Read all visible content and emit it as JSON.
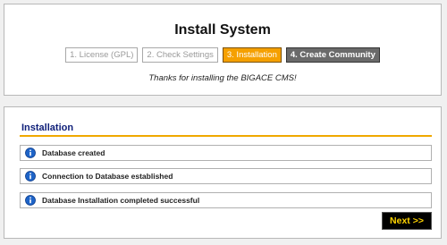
{
  "header": {
    "title": "Install System",
    "steps": [
      {
        "label": "1. License (GPL)",
        "state": "completed"
      },
      {
        "label": "2. Check Settings",
        "state": "completed"
      },
      {
        "label": "3. Installation",
        "state": "active"
      },
      {
        "label": "4. Create Community",
        "state": "upcoming"
      }
    ],
    "thanks": "Thanks for installing the BIGACE CMS!"
  },
  "main": {
    "section_title": "Installation",
    "messages": [
      {
        "icon": "info-icon",
        "text": "Database created"
      },
      {
        "icon": "info-icon",
        "text": "Connection to Database established"
      },
      {
        "icon": "info-icon",
        "text": "Database Installation completed successful"
      }
    ],
    "next_label": "Next >>"
  },
  "colors": {
    "accent": "#f5a000",
    "section_title": "#10207a",
    "info_icon": "#1e64c8",
    "next_text": "#ffd400"
  }
}
